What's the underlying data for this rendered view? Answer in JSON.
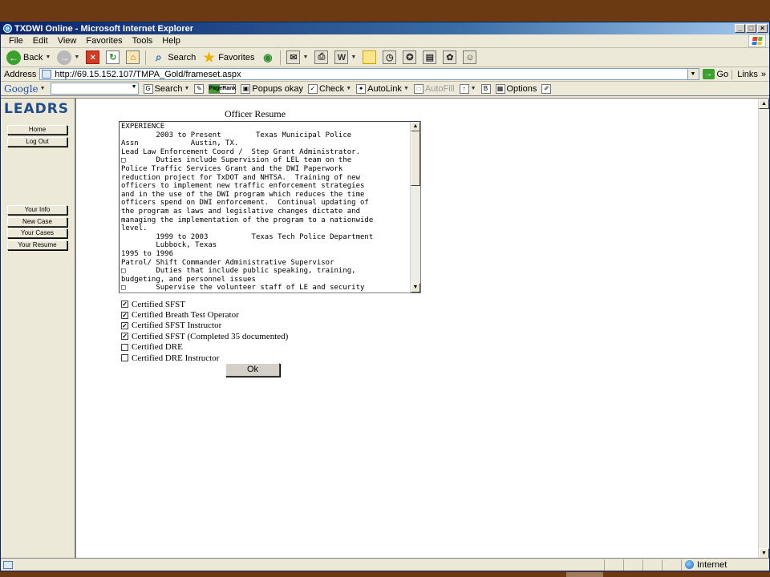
{
  "window": {
    "title": "TXDWI Online - Microsoft Internet Explorer",
    "min": "_",
    "max": "□",
    "close": "×"
  },
  "menu": [
    "File",
    "Edit",
    "View",
    "Favorites",
    "Tools",
    "Help"
  ],
  "toolbar": {
    "back": "Back",
    "search": "Search",
    "favorites": "Favorites"
  },
  "address": {
    "label": "Address",
    "url": "http://69.15.152.107/TMPA_Gold/frameset.aspx",
    "go": "Go",
    "links": "Links"
  },
  "google": {
    "logo": "Google",
    "search": "Search",
    "pagerank": "PageRank",
    "popups": "Popups okay",
    "check": "Check",
    "autolink": "AutoLink",
    "autofill": "AutoFill",
    "options": "Options"
  },
  "sidebar": {
    "logo": "LEADRS",
    "items": [
      "Home",
      "Log Out",
      "Your Info",
      "New Case",
      "Your Cases",
      "Your Resume"
    ]
  },
  "main": {
    "title": "Officer Resume",
    "resume_text": "EXPERIENCE\n        2003 to Present        Texas Municipal Police\nAssn            Austin, TX.\nLead Law Enforcement Coord /  Step Grant Administrator.\n□       Duties include Supervision of LEL team on the\nPolice Traffic Services Grant and the DWI Paperwork\nreduction project for TxDOT and NHTSA.  Training of new\nofficers to implement new traffic enforcement strategies\nand in the use of the DWI program which reduces the time\nofficers spend on DWI enforcement.  Continual updating of\nthe program as laws and legislative changes dictate and\nmanaging the implementation of the program to a nationwide\nlevel.\n        1999 to 2003          Texas Tech Police Department\n        Lubbock, Texas\n1995 to 1996\nPatrol/ Shift Commander Administrative Supervisor\n□       Duties that include public speaking, training,\nbudgeting, and personnel issues\n□       Supervise the volunteer staff of LE and security",
    "certifications": [
      {
        "label": "Certified SFST",
        "checked": true
      },
      {
        "label": "Certified Breath Test Operator",
        "checked": true
      },
      {
        "label": "Certified SFST Instructor",
        "checked": true
      },
      {
        "label": "Certified SFST (Completed 35 documented)",
        "checked": true
      },
      {
        "label": "Certified DRE",
        "checked": false
      },
      {
        "label": "Certified DRE Instructor",
        "checked": false
      }
    ],
    "ok": "Ok"
  },
  "status": {
    "zone": "Internet"
  }
}
